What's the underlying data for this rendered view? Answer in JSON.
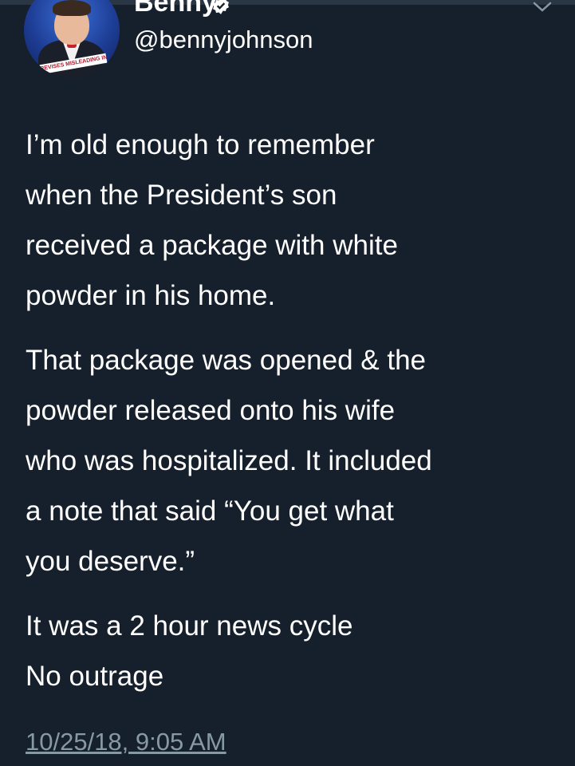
{
  "account": {
    "display_name": "Benny",
    "handle": "@bennyjohnson",
    "avatar_banner_text": "REVISES MISLEADING INFORMATION"
  },
  "tweet": {
    "paragraphs": [
      [
        "I’m old enough to remember",
        "when the President’s son",
        "received a package with white",
        "powder in his home."
      ],
      [
        "That package was opened & the",
        "powder released onto his wife",
        "who was hospitalized. It included",
        "a note that said “You get what",
        "you deserve.”"
      ],
      [
        "It was a 2 hour news cycle",
        "No outrage"
      ]
    ],
    "timestamp": "10/25/18, 9:05 AM"
  },
  "icons": {
    "verified": "verified-badge-icon",
    "menu": "chevron-down-icon"
  },
  "colors": {
    "background": "#16202c",
    "text": "#ffffff",
    "muted": "#8899a6"
  }
}
